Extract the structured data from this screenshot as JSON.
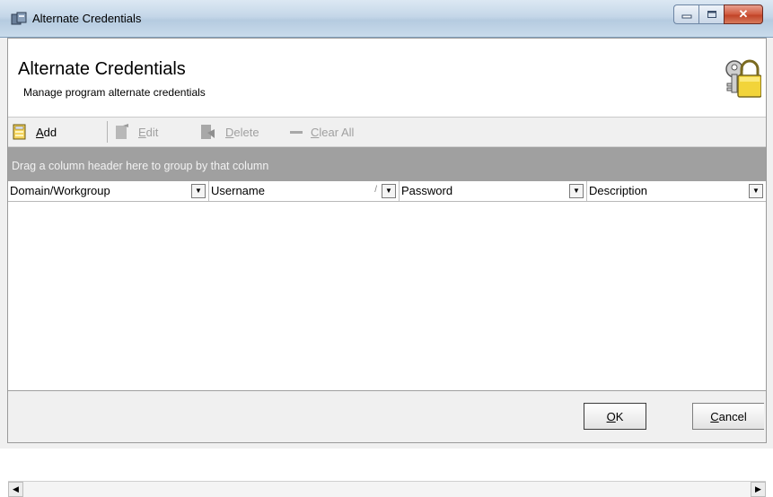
{
  "window": {
    "title": "Alternate Credentials"
  },
  "header": {
    "title": "Alternate Credentials",
    "subtitle": "Manage program alternate credentials"
  },
  "toolbar": {
    "add": {
      "label": "Add",
      "mnemonic": "A",
      "rest": "dd"
    },
    "edit": {
      "label": "Edit",
      "mnemonic": "E",
      "rest": "dit"
    },
    "delete": {
      "label": "Delete",
      "mnemonic": "D",
      "rest": "elete"
    },
    "clear_all": {
      "label": "Clear All",
      "mnemonic": "C",
      "rest": "lear All"
    }
  },
  "grid": {
    "group_hint": "Drag a column header here to group by that column",
    "columns": [
      {
        "label": "Domain/Workgroup"
      },
      {
        "label": "Username",
        "sort": "/"
      },
      {
        "label": "Password"
      },
      {
        "label": "Description"
      }
    ],
    "rows": []
  },
  "footer": {
    "ok": {
      "label": "OK",
      "mnemonic": "O",
      "rest": "K"
    },
    "cancel": {
      "label": "Cancel",
      "mnemonic": "C",
      "rest": "ancel"
    }
  },
  "icons": {
    "window": "credentials-window-icon",
    "header": "padlock-keys-icon",
    "add": "add-record-icon",
    "edit": "edit-record-icon",
    "delete": "delete-record-icon",
    "clear_all": "clear-all-icon"
  },
  "colors": {
    "groupbar": "#a0a0a0",
    "header_bg": "#ffffff",
    "disabled_text": "#a0a0a0"
  }
}
